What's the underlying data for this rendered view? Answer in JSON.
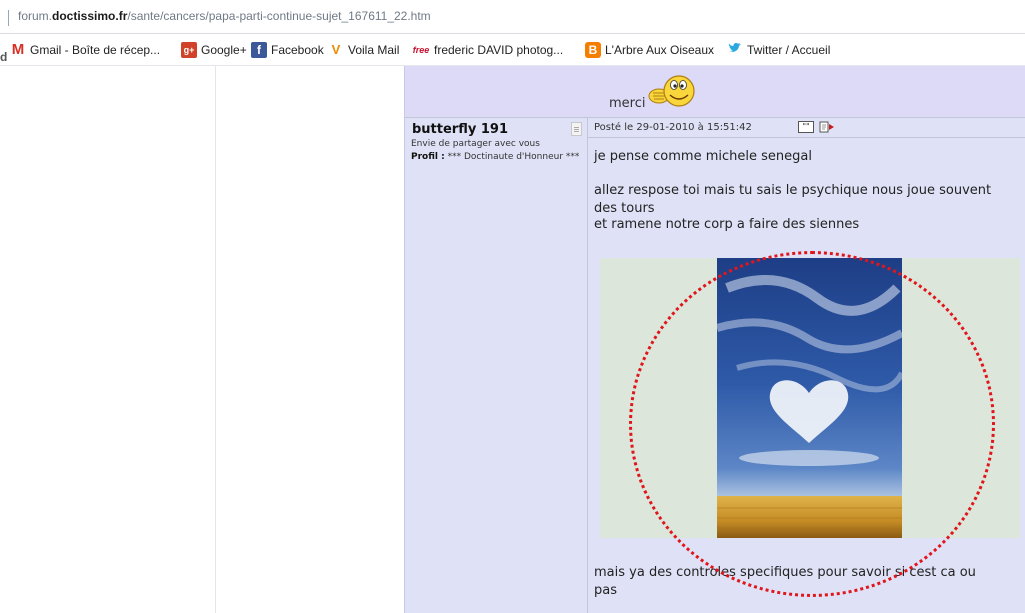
{
  "browser": {
    "url_prefix": "forum.",
    "url_domain": "doctissimo.fr",
    "url_path": "/sante/cancers/papa-parti-continue-sujet_167611_22.htm"
  },
  "bookmarks": [
    {
      "label": "Gmail - Boîte de récep...",
      "icon": "gmail-icon",
      "glyph": "M"
    },
    {
      "label": "Google+",
      "icon": "google-plus-icon",
      "glyph": "g+"
    },
    {
      "label": "Facebook",
      "icon": "facebook-icon",
      "glyph": "f"
    },
    {
      "label": "Voila Mail",
      "icon": "voila-icon",
      "glyph": "V"
    },
    {
      "label": "frederic DAVID photog...",
      "icon": "free-icon",
      "glyph": "free"
    },
    {
      "label": "L'Arbre Aux Oiseaux",
      "icon": "blogger-icon",
      "glyph": "B"
    },
    {
      "label": "Twitter / Accueil",
      "icon": "twitter-icon",
      "glyph": "❯"
    }
  ],
  "previous_post": {
    "text": "merci"
  },
  "post": {
    "author": "butterfly 191",
    "tagline": "Envie de partager avec vous",
    "profil_label": "Profil :",
    "profil_value": "*** Doctinaute d'Honneur ***",
    "date": "Posté le 29-01-2010 à 15:51:42",
    "quote_icon_text": "\"\"",
    "lines": [
      "je pense comme michele senegal",
      "allez respose toi mais tu sais le psychique nous joue souvent",
      "des tours",
      "et ramene notre corp a faire des siennes",
      "mais ya des controles specifiques pour savoir si cest ca ou",
      "pas"
    ]
  },
  "colors": {
    "post_bg": "#dfe2f6",
    "annotation_circle": "#e0161c"
  }
}
